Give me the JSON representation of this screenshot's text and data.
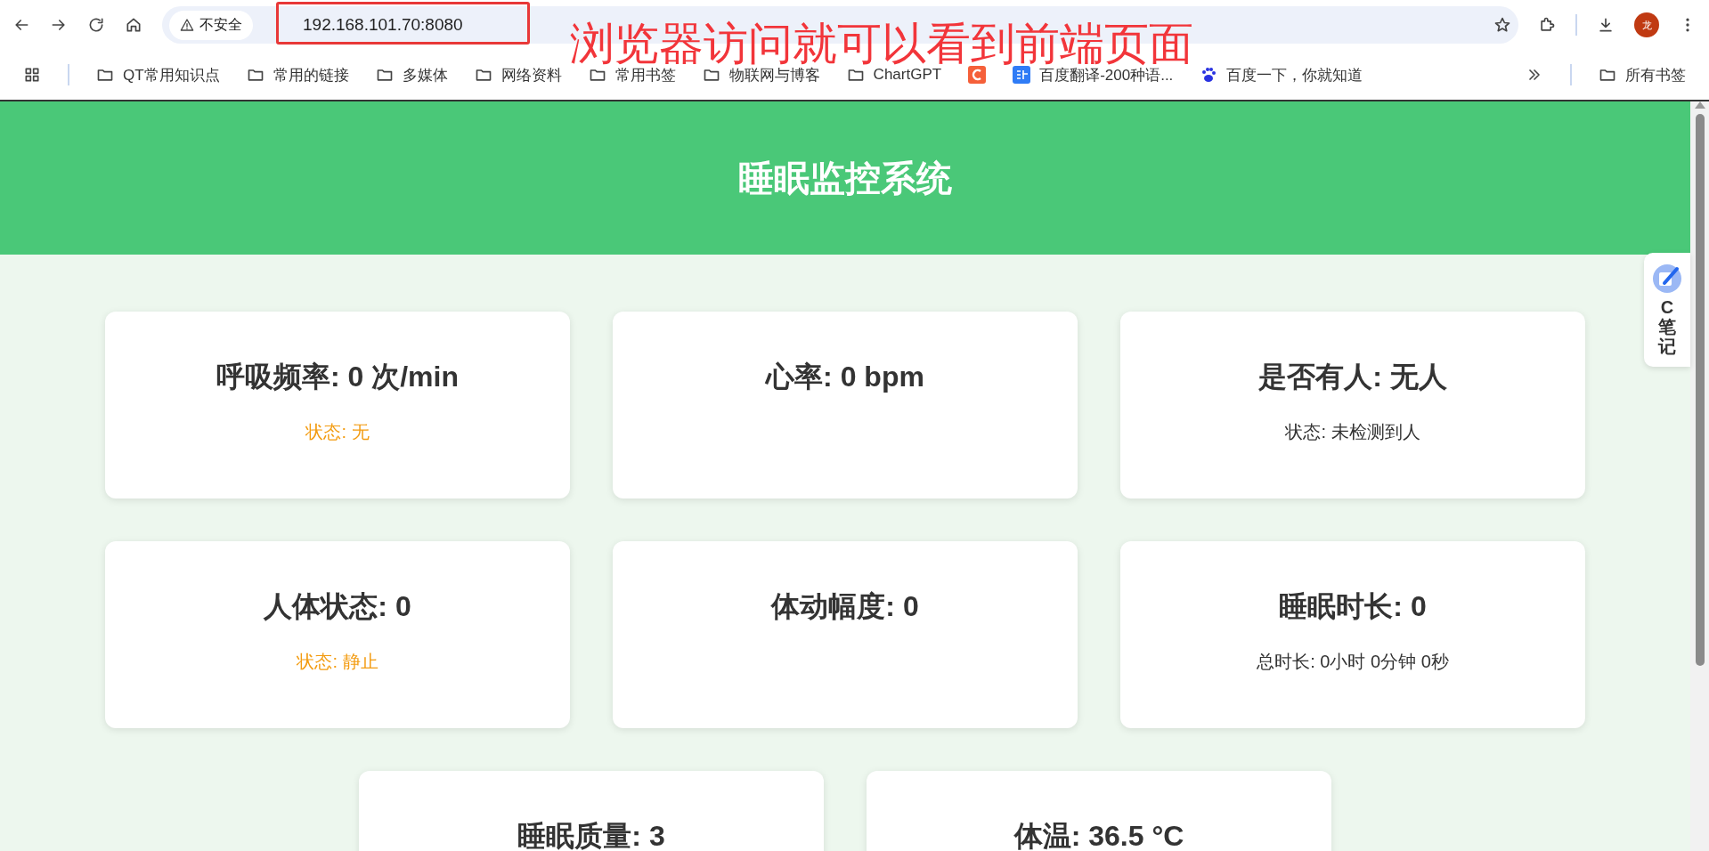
{
  "browser": {
    "security_label": "不安全",
    "url": "192.168.101.70:8080",
    "avatar": "龙"
  },
  "bookmarks": [
    {
      "label": "QT常用知识点",
      "kind": "folder"
    },
    {
      "label": "常用的链接",
      "kind": "folder"
    },
    {
      "label": "多媒体",
      "kind": "folder"
    },
    {
      "label": "网络资料",
      "kind": "folder"
    },
    {
      "label": "常用书签",
      "kind": "folder"
    },
    {
      "label": "物联网与博客",
      "kind": "folder"
    },
    {
      "label": "ChartGPT",
      "kind": "folder"
    },
    {
      "kind": "c-logo"
    },
    {
      "label": "百度翻译-200种语...",
      "kind": "translate"
    },
    {
      "label": "百度一下，你就知道",
      "kind": "paw"
    }
  ],
  "all_bookmarks": "所有书签",
  "annotation": "浏览器访问就可以看到前端页面",
  "page": {
    "title": "睡眠监控系统",
    "cards": [
      {
        "title": "呼吸频率: 0 次/min",
        "status": "状态: 无",
        "color": "#f39c12"
      },
      {
        "title": "心率: 0 bpm"
      },
      {
        "title": "是否有人: 无人",
        "status": "状态: 未检测到人",
        "color": "#333333"
      },
      {
        "title": "人体状态: 0",
        "status": "状态: 静止",
        "color": "#f39c12"
      },
      {
        "title": "体动幅度: 0"
      },
      {
        "title": "睡眠时长: 0",
        "status": "总时长: 0小时 0分钟 0秒",
        "color": "#333333"
      },
      {
        "title": "睡眠质量: 3"
      },
      {
        "title": "体温: 36.5 °C"
      }
    ]
  },
  "side_widget": {
    "label": "C笔记"
  }
}
